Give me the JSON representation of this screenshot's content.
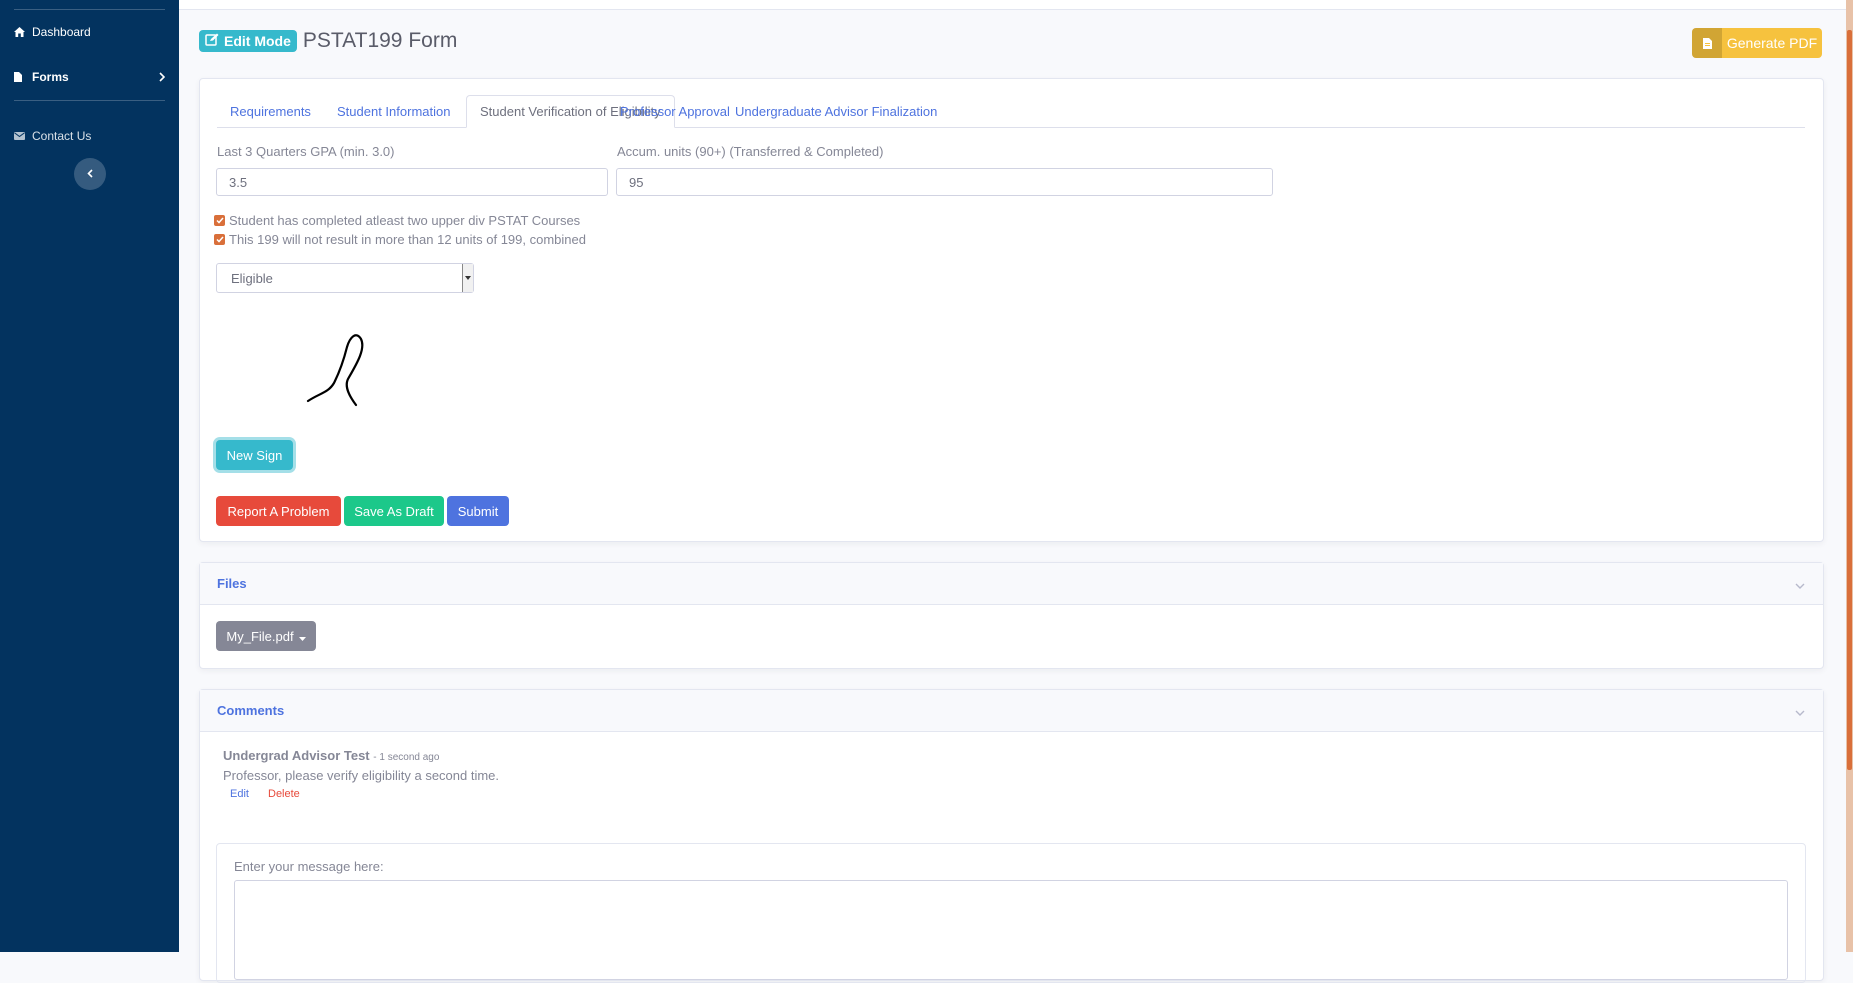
{
  "sidebar": {
    "items": [
      {
        "label": "Dashboard",
        "icon": "home-icon"
      },
      {
        "label": "Forms",
        "icon": "file-icon"
      },
      {
        "label": "Contact Us",
        "icon": "envelope-icon"
      }
    ]
  },
  "header": {
    "mode_badge": "Edit Mode",
    "title": "PSTAT199 Form",
    "pdf_button": "Generate PDF"
  },
  "tabs": [
    {
      "label": "Requirements"
    },
    {
      "label": "Student Information"
    },
    {
      "label": "Student Verification of Eligibility",
      "active": true
    },
    {
      "label": "Professor Approval"
    },
    {
      "label": "Undergraduate Advisor Finalization"
    }
  ],
  "form": {
    "gpa_label": "Last 3 Quarters GPA (min. 3.0)",
    "gpa_value": "3.5",
    "units_label": "Accum. units (90+) (Transferred & Completed)",
    "units_value": "95",
    "check1": "Student has completed atleast two upper div PSTAT Courses",
    "check2": "This 199 will not result in more than 12 units of 199, combined",
    "eligibility": "Eligible",
    "new_sign": "New Sign",
    "report": "Report A Problem",
    "draft": "Save As Draft",
    "submit": "Submit"
  },
  "files": {
    "header": "Files",
    "file_button": "My_File.pdf"
  },
  "comments": {
    "header": "Comments",
    "author": "Undergrad Advisor Test",
    "time": "- 1 second ago",
    "body": "Professor, please verify eligibility a second time.",
    "edit": "Edit",
    "delete": "Delete",
    "message_label": "Enter your message here:"
  },
  "colors": {
    "sidebar": "#03335f",
    "primary": "#4e73df",
    "info": "#36b9cc",
    "warning": "#f6c23e",
    "danger": "#e74a3b",
    "success": "#1cc88a",
    "secondary": "#858796"
  }
}
